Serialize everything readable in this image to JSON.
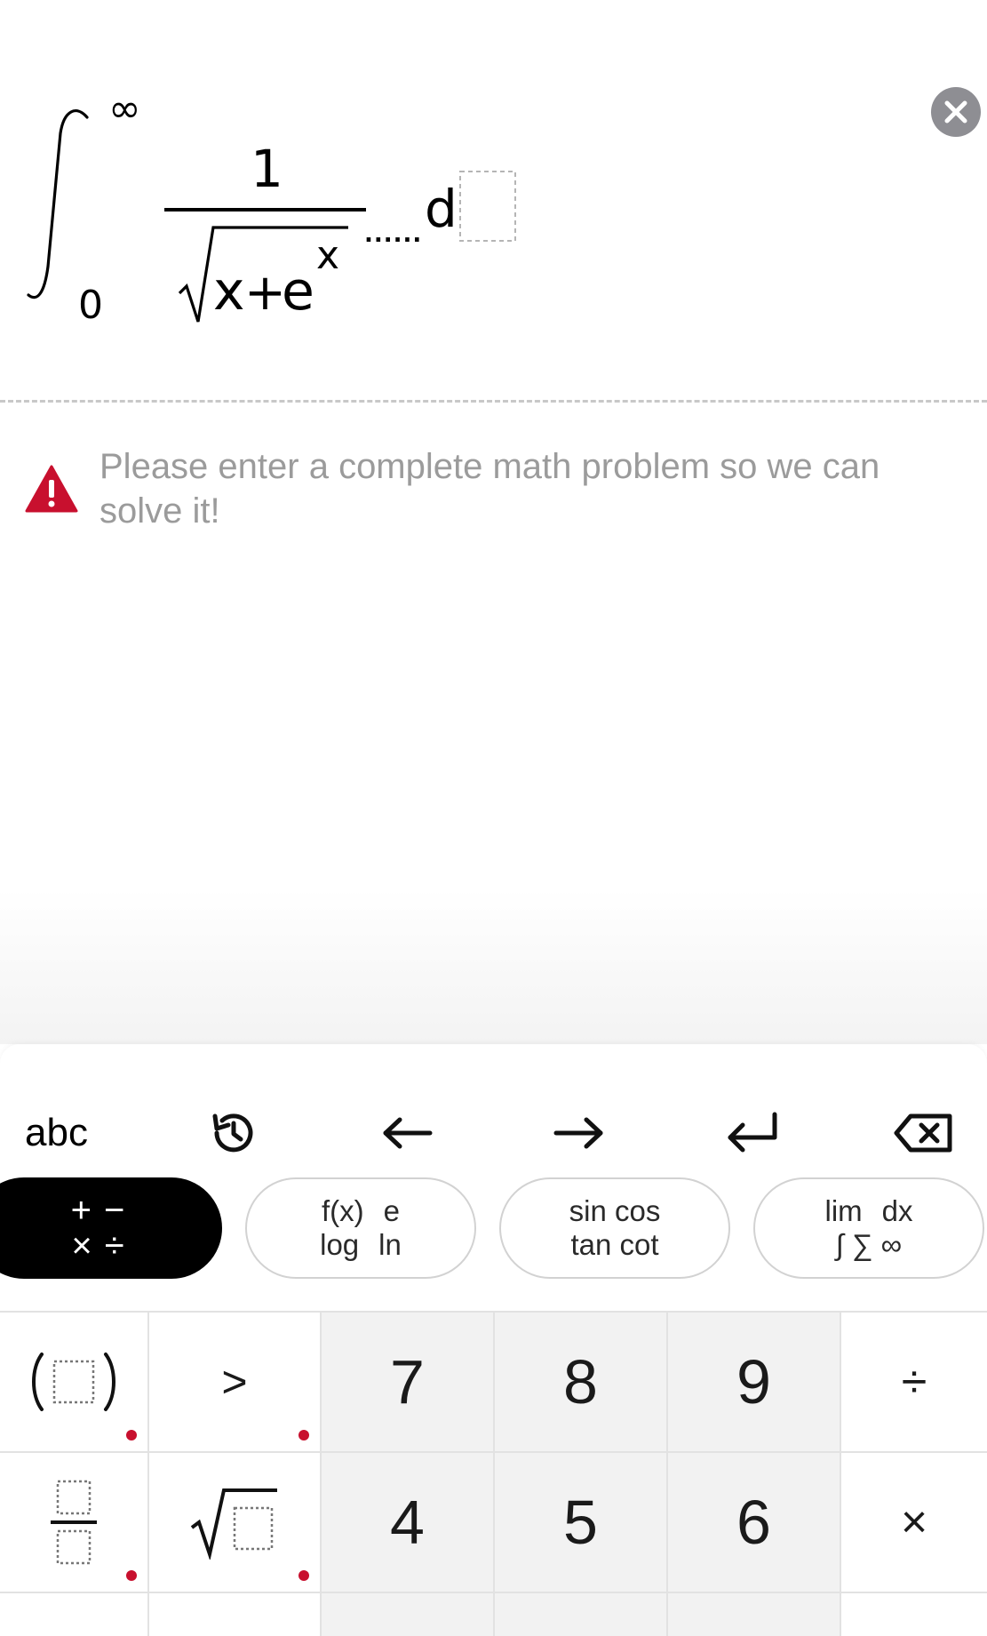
{
  "expression": {
    "upper_limit": "∞",
    "lower_limit": "0",
    "numerator": "1",
    "radicand_x": "x",
    "radicand_plus": "+",
    "radicand_e": "e",
    "exponent": "x",
    "dots": "......",
    "differential": "d"
  },
  "warning": {
    "line1": "Please enter a complete math problem so we can",
    "line2": "solve it!"
  },
  "toolbar": {
    "abc_label": "abc"
  },
  "categories": {
    "basic": {
      "line1a": "+",
      "line1b": "−",
      "line2a": "×",
      "line2b": "÷"
    },
    "functions": {
      "line1a": "f(x)",
      "line1b": "e",
      "line2a": "log",
      "line2b": "ln"
    },
    "trig": {
      "line1": "sin cos",
      "line2": "tan cot"
    },
    "calculus": {
      "line1a": "lim",
      "line1b": "dx",
      "line2": "∫ ∑ ∞"
    }
  },
  "keys": {
    "greater": ">",
    "seven": "7",
    "eight": "8",
    "nine": "9",
    "divide": "÷",
    "four": "4",
    "five": "5",
    "six": "6",
    "times": "×"
  },
  "colors": {
    "accent_red": "#c8102e",
    "muted_text": "#9b9b9b",
    "close_gray": "#8e8e93",
    "number_key_bg": "#f2f2f2"
  }
}
